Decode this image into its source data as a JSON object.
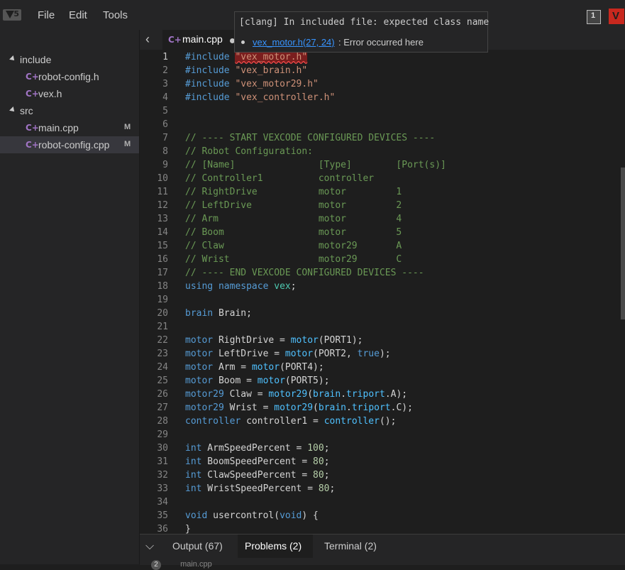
{
  "menubar": {
    "items": [
      "File",
      "Edit",
      "Tools"
    ],
    "logo_number": "5",
    "right_icon_1_glyph": "1"
  },
  "sidebar": {
    "items": [
      {
        "type": "folder",
        "label": "include"
      },
      {
        "type": "file",
        "label": "robot-config.h",
        "badge": ""
      },
      {
        "type": "file",
        "label": "vex.h",
        "badge": ""
      },
      {
        "type": "folder",
        "label": "src"
      },
      {
        "type": "file",
        "label": "main.cpp",
        "badge": "M"
      },
      {
        "type": "file",
        "label": "robot-config.cpp",
        "badge": "M"
      }
    ]
  },
  "tab": {
    "label": "main.cpp"
  },
  "tooltip": {
    "title": "[clang] In included file: expected class name",
    "link": "vex_motor.h(27, 24)",
    "message": ": Error occurred here"
  },
  "editor": {
    "lines": [
      {
        "n": "1",
        "t": [
          [
            "kw",
            "#include "
          ],
          [
            "str err",
            "\"vex_motor.h\""
          ]
        ]
      },
      {
        "n": "2",
        "t": [
          [
            "kw",
            "#include "
          ],
          [
            "str",
            "\"vex_brain.h\""
          ]
        ]
      },
      {
        "n": "3",
        "t": [
          [
            "kw",
            "#include "
          ],
          [
            "str",
            "\"vex_motor29.h\""
          ]
        ]
      },
      {
        "n": "4",
        "t": [
          [
            "kw",
            "#include "
          ],
          [
            "str",
            "\"vex_controller.h\""
          ]
        ]
      },
      {
        "n": "5",
        "t": []
      },
      {
        "n": "6",
        "t": []
      },
      {
        "n": "7",
        "t": [
          [
            "cmt",
            "// ---- START VEXCODE CONFIGURED DEVICES ----"
          ]
        ]
      },
      {
        "n": "8",
        "t": [
          [
            "cmt",
            "// Robot Configuration:"
          ]
        ]
      },
      {
        "n": "9",
        "t": [
          [
            "cmt",
            "// [Name]               [Type]        [Port(s)]"
          ]
        ]
      },
      {
        "n": "10",
        "t": [
          [
            "cmt",
            "// Controller1          controller"
          ]
        ]
      },
      {
        "n": "11",
        "t": [
          [
            "cmt",
            "// RightDrive           motor         1"
          ]
        ]
      },
      {
        "n": "12",
        "t": [
          [
            "cmt",
            "// LeftDrive            motor         2"
          ]
        ]
      },
      {
        "n": "13",
        "t": [
          [
            "cmt",
            "// Arm                  motor         4"
          ]
        ]
      },
      {
        "n": "14",
        "t": [
          [
            "cmt",
            "// Boom                 motor         5"
          ]
        ]
      },
      {
        "n": "15",
        "t": [
          [
            "cmt",
            "// Claw                 motor29       A"
          ]
        ]
      },
      {
        "n": "16",
        "t": [
          [
            "cmt",
            "// Wrist                motor29       C"
          ]
        ]
      },
      {
        "n": "17",
        "t": [
          [
            "cmt",
            "// ---- END VEXCODE CONFIGURED DEVICES ----"
          ]
        ]
      },
      {
        "n": "18",
        "t": [
          [
            "kw",
            "using"
          ],
          [
            "",
            " "
          ],
          [
            "kw",
            "namespace"
          ],
          [
            "",
            " "
          ],
          [
            "ty",
            "vex"
          ],
          [
            "",
            ";"
          ]
        ]
      },
      {
        "n": "19",
        "t": []
      },
      {
        "n": "20",
        "t": [
          [
            "kw",
            "brain"
          ],
          [
            "",
            " Brain;"
          ]
        ]
      },
      {
        "n": "21",
        "t": []
      },
      {
        "n": "22",
        "t": [
          [
            "kw",
            "motor"
          ],
          [
            "",
            " RightDrive = "
          ],
          [
            "fn",
            "motor"
          ],
          [
            "",
            "(PORT1);"
          ]
        ]
      },
      {
        "n": "23",
        "t": [
          [
            "kw",
            "motor"
          ],
          [
            "",
            " LeftDrive = "
          ],
          [
            "fn",
            "motor"
          ],
          [
            "",
            "(PORT2, "
          ],
          [
            "kw",
            "true"
          ],
          [
            "",
            ");"
          ]
        ]
      },
      {
        "n": "24",
        "t": [
          [
            "kw",
            "motor"
          ],
          [
            "",
            " Arm = "
          ],
          [
            "fn",
            "motor"
          ],
          [
            "",
            "(PORT4);"
          ]
        ]
      },
      {
        "n": "25",
        "t": [
          [
            "kw",
            "motor"
          ],
          [
            "",
            " Boom = "
          ],
          [
            "fn",
            "motor"
          ],
          [
            "",
            "(PORT5);"
          ]
        ]
      },
      {
        "n": "26",
        "t": [
          [
            "kw",
            "motor29"
          ],
          [
            "",
            " Claw = "
          ],
          [
            "fn",
            "motor29"
          ],
          [
            "",
            "("
          ],
          [
            "fn",
            "brain"
          ],
          [
            "",
            "."
          ],
          [
            "fn",
            "triport"
          ],
          [
            "",
            ".A);"
          ]
        ]
      },
      {
        "n": "27",
        "t": [
          [
            "kw",
            "motor29"
          ],
          [
            "",
            " Wrist = "
          ],
          [
            "fn",
            "motor29"
          ],
          [
            "",
            "("
          ],
          [
            "fn",
            "brain"
          ],
          [
            "",
            "."
          ],
          [
            "fn",
            "triport"
          ],
          [
            "",
            ".C);"
          ]
        ]
      },
      {
        "n": "28",
        "t": [
          [
            "kw",
            "controller"
          ],
          [
            "",
            " controller1 = "
          ],
          [
            "fn",
            "controller"
          ],
          [
            "",
            "();"
          ]
        ]
      },
      {
        "n": "29",
        "t": []
      },
      {
        "n": "30",
        "t": [
          [
            "kw",
            "int"
          ],
          [
            "",
            " ArmSpeedPercent = "
          ],
          [
            "num",
            "100"
          ],
          [
            "",
            ";"
          ]
        ]
      },
      {
        "n": "31",
        "t": [
          [
            "kw",
            "int"
          ],
          [
            "",
            " BoomSpeedPercent = "
          ],
          [
            "num",
            "80"
          ],
          [
            "",
            ";"
          ]
        ]
      },
      {
        "n": "32",
        "t": [
          [
            "kw",
            "int"
          ],
          [
            "",
            " ClawSpeedPercent = "
          ],
          [
            "num",
            "80"
          ],
          [
            "",
            ";"
          ]
        ]
      },
      {
        "n": "33",
        "t": [
          [
            "kw",
            "int"
          ],
          [
            "",
            " WristSpeedPercent = "
          ],
          [
            "num",
            "80"
          ],
          [
            "",
            ";"
          ]
        ]
      },
      {
        "n": "34",
        "t": []
      },
      {
        "n": "35",
        "t": [
          [
            "kw",
            "void"
          ],
          [
            "",
            " usercontrol("
          ],
          [
            "kw",
            "void"
          ],
          [
            "",
            ") {"
          ]
        ]
      },
      {
        "n": "36",
        "t": [
          [
            "",
            "}"
          ]
        ]
      }
    ]
  },
  "panel": {
    "tabs": [
      {
        "label": "Output (67)",
        "active": false
      },
      {
        "label": "Problems (2)",
        "active": true
      },
      {
        "label": "Terminal (2)",
        "active": false
      }
    ],
    "problem_count": "2",
    "problem_file": "main.cpp"
  },
  "colors": {
    "accent_red": "#c8281e",
    "keyword": "#569cd6",
    "string": "#ce9178",
    "comment": "#6a9955",
    "number": "#b5cea8",
    "function": "#4fc1ff",
    "link": "#3794ff"
  }
}
